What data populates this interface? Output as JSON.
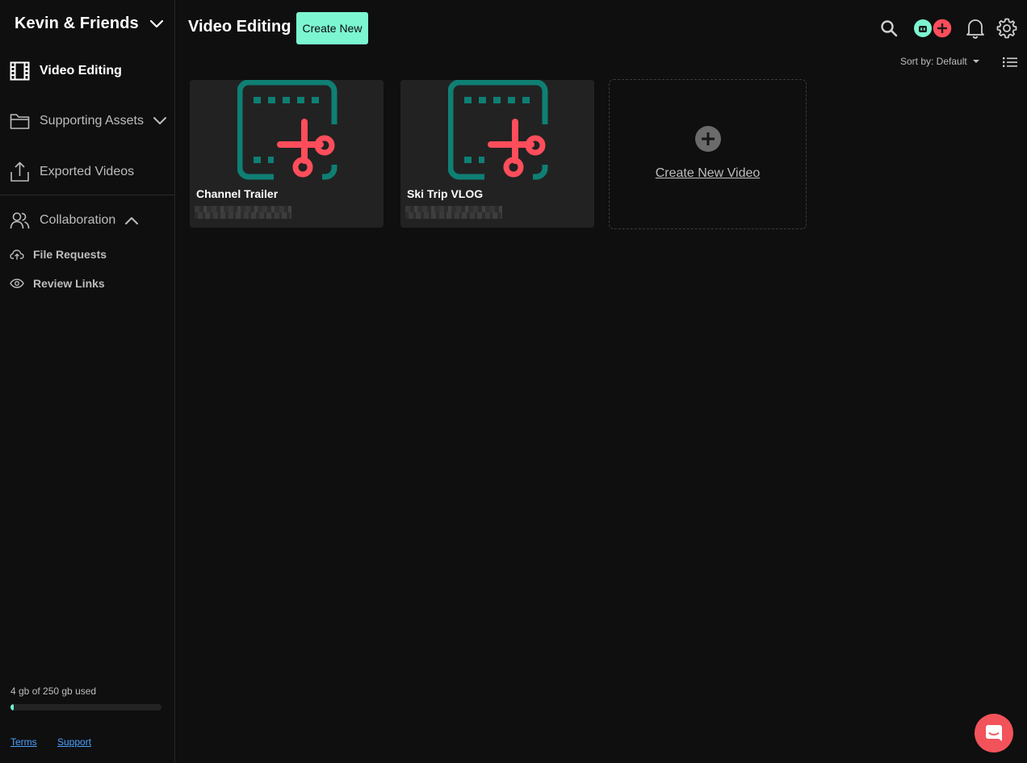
{
  "workspace": {
    "name": "Kevin & Friends"
  },
  "sidebar": {
    "items": [
      {
        "label": "Video Editing"
      },
      {
        "label": "Supporting Assets"
      },
      {
        "label": "Exported Videos"
      },
      {
        "label": "Collaboration"
      }
    ],
    "sub_items": [
      {
        "label": "File Requests"
      },
      {
        "label": "Review Links"
      }
    ],
    "storage": {
      "text": "4 gb of 250 gb used",
      "used_fraction": 0.016
    },
    "footer": {
      "terms": "Terms",
      "support": "Support"
    }
  },
  "header": {
    "title": "Video Editing",
    "create_new_label": "Create New",
    "sort_label": "Sort by: Default"
  },
  "cards": [
    {
      "title": "Channel Trailer"
    },
    {
      "title": "Ski Trip VLOG"
    }
  ],
  "new_card": {
    "label": "Create New Video"
  },
  "colors": {
    "accent": "#7cf6d1",
    "thumb_frame": "#0f7f74",
    "scissors": "#ff4d5b",
    "chat": "#f2535a",
    "background": "#0f0f0f",
    "card": "#222222"
  },
  "icons": {
    "workspace": "chevron-down-icon",
    "video_editing": "film-icon",
    "supporting_assets": "folder-icon",
    "exported_videos": "upload-icon",
    "collaboration": "users-icon",
    "file_requests": "cloud-upload-icon",
    "review_links": "eye-icon",
    "search": "search-icon",
    "notifications": "bell-icon",
    "settings": "gear-icon",
    "list_view": "list-icon",
    "chat": "chat-icon"
  }
}
